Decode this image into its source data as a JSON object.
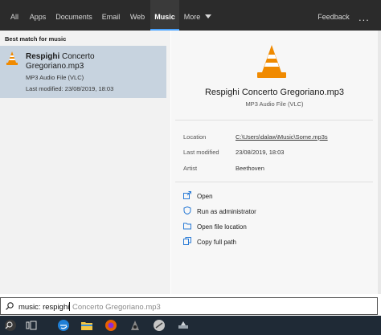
{
  "tabs": [
    {
      "label": "All"
    },
    {
      "label": "Apps"
    },
    {
      "label": "Documents"
    },
    {
      "label": "Email"
    },
    {
      "label": "Web"
    },
    {
      "label": "Music"
    },
    {
      "label": "More"
    }
  ],
  "feedback_label": "Feedback",
  "more_options": "...",
  "left": {
    "section_title": "Best match for music",
    "result": {
      "name_bold": "Respighi",
      "name_rest": " Concerto",
      "name_line2": "Gregoriano.mp3",
      "type": "MP3 Audio File (VLC)",
      "modified": "Last modified: 23/08/2019, 18:03"
    }
  },
  "preview": {
    "title": "Respighi Concerto Gregoriano.mp3",
    "type": "MP3 Audio File (VLC)",
    "location_label": "Location",
    "location_value": "C:\\Users\\dalaw\\Music\\Some.mp3s",
    "modified_label": "Last modified",
    "modified_value": "23/08/2019, 18:03",
    "artist_label": "Artist",
    "artist_value": "Beethoven",
    "actions": [
      {
        "label": "Open"
      },
      {
        "label": "Run as administrator"
      },
      {
        "label": "Open file location"
      },
      {
        "label": "Copy full path"
      }
    ]
  },
  "search": {
    "typed": "music: respighi",
    "suggestion": " Concerto Gregoriano.mp3"
  },
  "colors": {
    "topbar": "#2b2b2b",
    "selected_result": "#c7d3df",
    "accent": "#4aa3ff",
    "vlc_orange": "#f08a00"
  },
  "taskbar_icons": [
    "start-icon",
    "task-view-icon",
    "edge-icon",
    "file-explorer-icon",
    "firefox-icon",
    "app-icon",
    "app-icon",
    "app-icon"
  ]
}
